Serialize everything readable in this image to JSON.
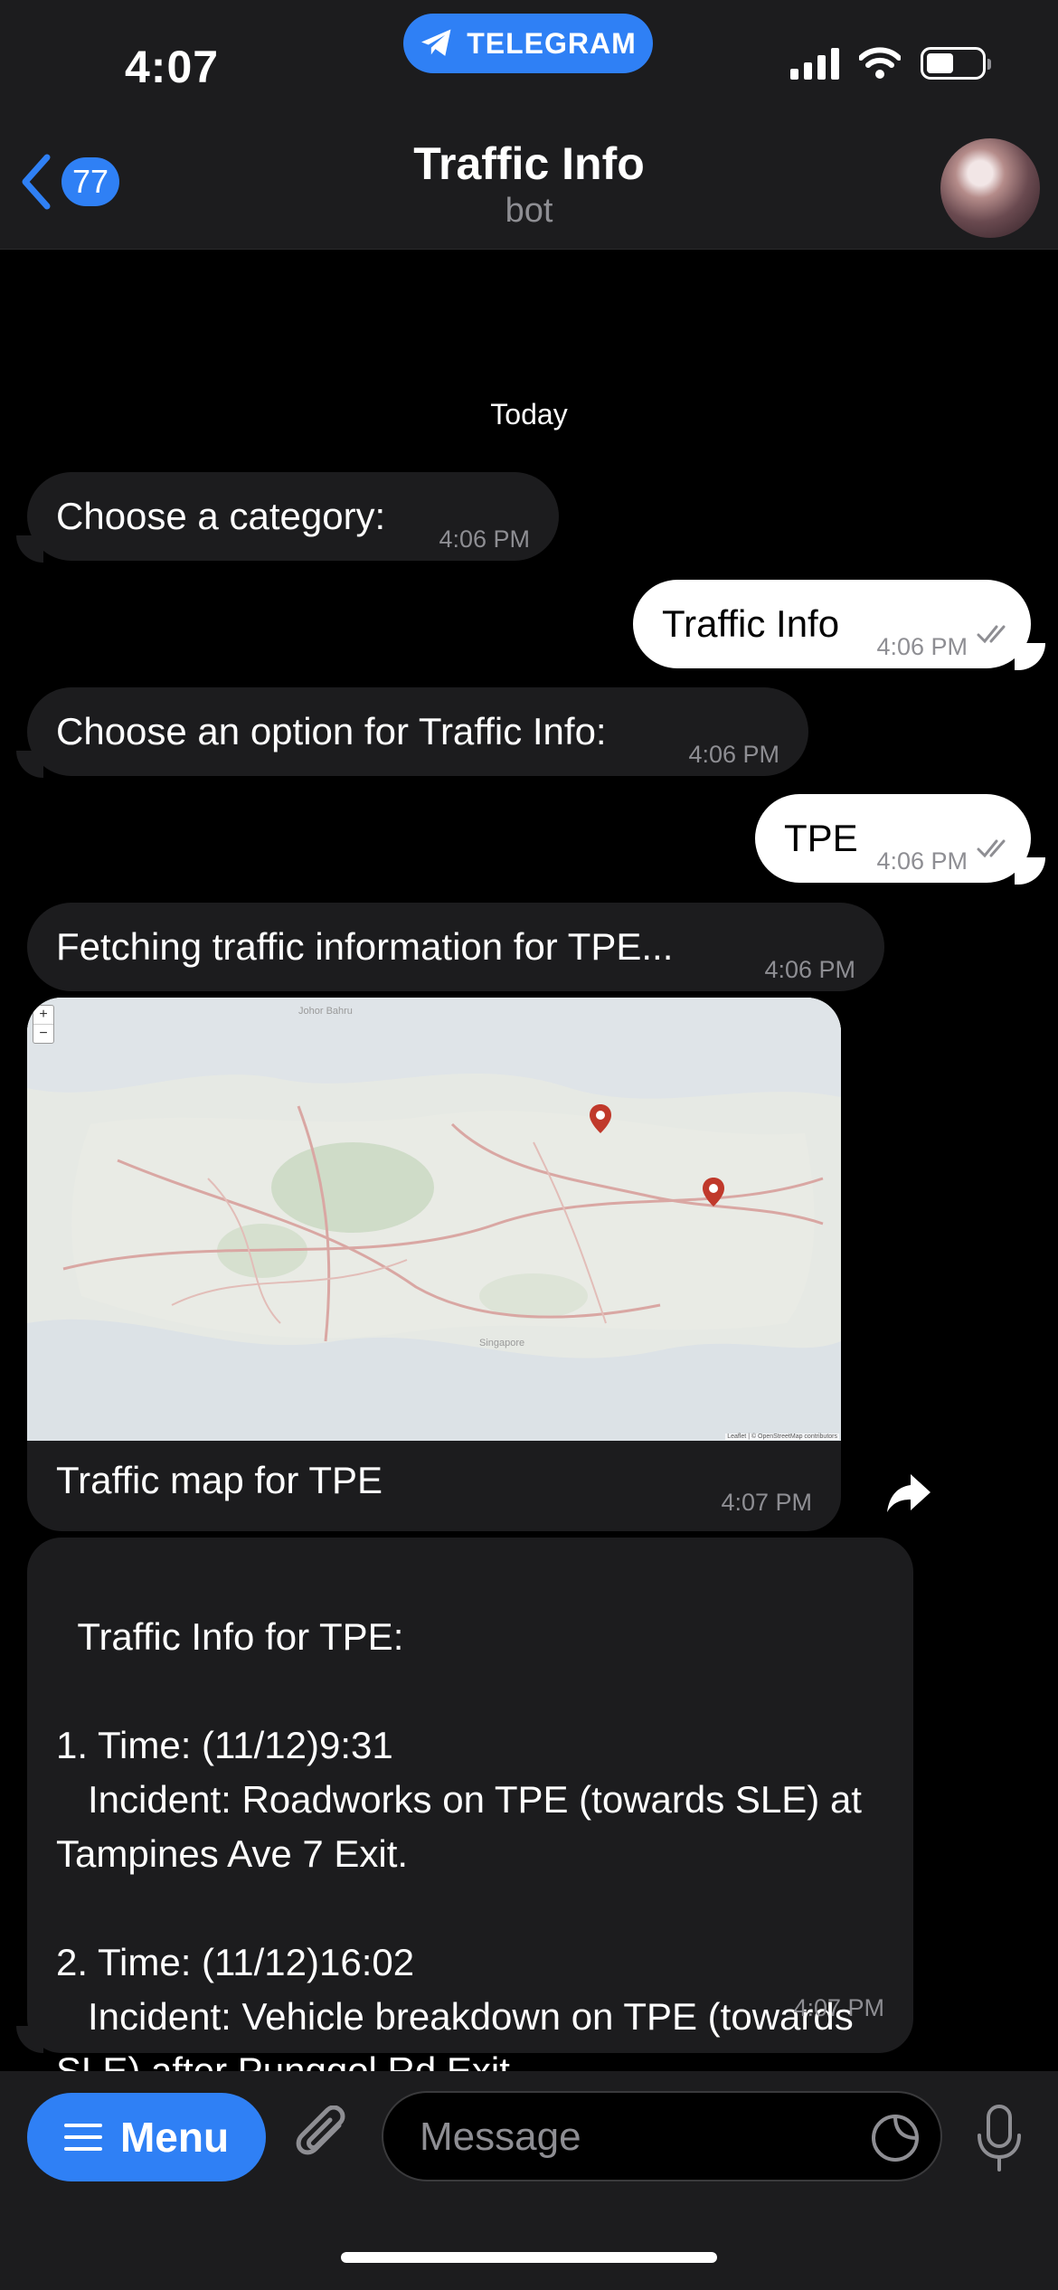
{
  "status_bar": {
    "time": "4:07",
    "app_pill": "TELEGRAM"
  },
  "header": {
    "back_count": "77",
    "title": "Traffic Info",
    "subtitle": "bot"
  },
  "chat": {
    "date_separator": "Today",
    "messages": [
      {
        "dir": "in",
        "text": "Choose a category:",
        "time": "4:06 PM"
      },
      {
        "dir": "out",
        "text": "Traffic Info",
        "time": "4:06 PM"
      },
      {
        "dir": "in",
        "text": "Choose an option for Traffic Info:",
        "time": "4:06 PM"
      },
      {
        "dir": "out",
        "text": "TPE",
        "time": "4:06 PM"
      },
      {
        "dir": "in",
        "text": "Fetching traffic information for TPE...",
        "time": "4:06 PM"
      }
    ],
    "map_message": {
      "caption": "Traffic map for TPE",
      "time": "4:07 PM",
      "zoom_in": "+",
      "zoom_out": "−",
      "attribution": "Leaflet | © OpenStreetMap contributors",
      "city_label": "Singapore",
      "johor_label": "Johor Bahru"
    },
    "info_message": {
      "text": "Traffic Info for TPE:\n\n1. Time: (11/12)9:31\n   Incident: Roadworks on TPE (towards SLE) at Tampines Ave 7 Exit.\n\n2. Time: (11/12)16:02\n   Incident: Vehicle breakdown on TPE (towards SLE) after Punggol Rd Exit.",
      "time": "4:07 PM"
    }
  },
  "input_bar": {
    "menu_label": "Menu",
    "placeholder": "Message"
  },
  "colors": {
    "accent": "#2f80f5",
    "bubble_in": "#1c1c1e",
    "bubble_out": "#ffffff"
  }
}
